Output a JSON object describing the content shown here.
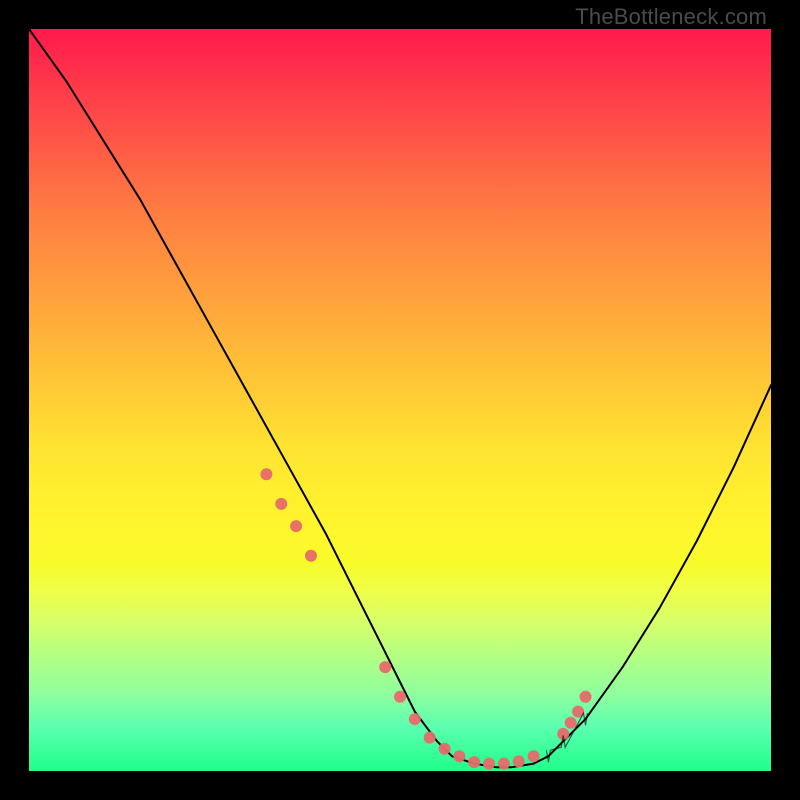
{
  "watermark": "TheBottleneck.com",
  "chart_data": {
    "type": "line",
    "title": "",
    "xlabel": "",
    "ylabel": "",
    "xlim": [
      0,
      100
    ],
    "ylim": [
      0,
      100
    ],
    "grid": false,
    "legend": false,
    "series": [
      {
        "name": "bottleneck-curve",
        "x": [
          0,
          5,
          10,
          15,
          20,
          25,
          30,
          35,
          40,
          45,
          48,
          50,
          52,
          55,
          57,
          60,
          63,
          65,
          68,
          70,
          72,
          75,
          80,
          85,
          90,
          95,
          100
        ],
        "y": [
          100,
          93,
          85,
          77,
          68,
          59,
          50,
          41,
          32,
          22,
          16,
          12,
          8,
          4,
          2,
          1,
          0.5,
          0.5,
          1,
          2,
          4,
          7,
          14,
          22,
          31,
          41,
          52
        ]
      }
    ],
    "markers": {
      "name": "scatter-points",
      "color": "#e86a6a",
      "x": [
        32,
        34,
        36,
        38,
        48,
        50,
        52,
        54,
        56,
        58,
        60,
        62,
        64,
        66,
        68,
        72,
        73,
        74,
        75
      ],
      "y": [
        40,
        36,
        33,
        29,
        14,
        10,
        7,
        4.5,
        3,
        2,
        1.2,
        1,
        1,
        1.3,
        2,
        5,
        6.5,
        8,
        10
      ]
    }
  }
}
